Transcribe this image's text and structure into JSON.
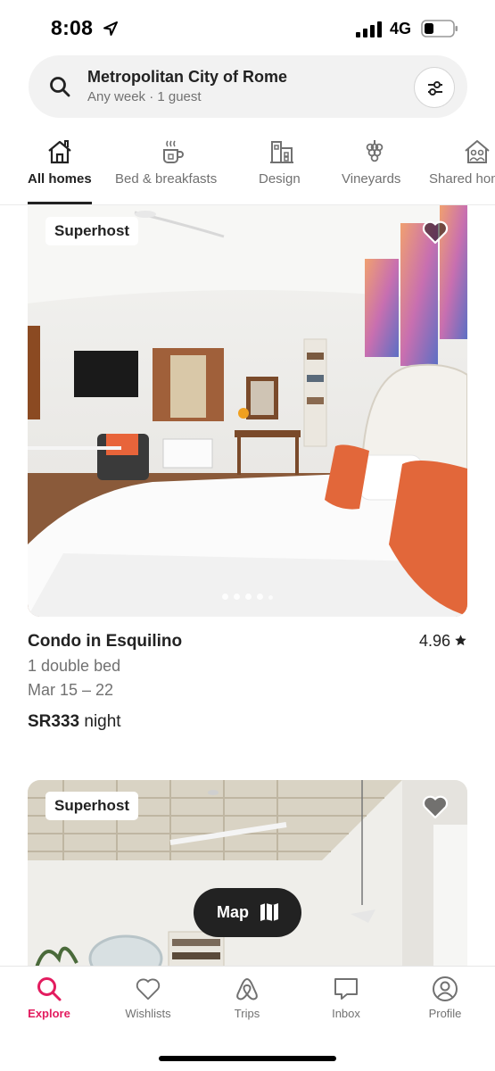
{
  "status": {
    "time": "8:08",
    "network": "4G"
  },
  "search": {
    "title": "Metropolitan City of Rome",
    "subtitle": "Any week · 1 guest"
  },
  "categories": [
    {
      "label": "All homes",
      "icon": "home-icon",
      "active": true
    },
    {
      "label": "Bed & breakfasts",
      "icon": "mug-icon"
    },
    {
      "label": "Design",
      "icon": "building-icon"
    },
    {
      "label": "Vineyards",
      "icon": "grapes-icon"
    },
    {
      "label": "Shared homes",
      "icon": "shared-home-icon"
    }
  ],
  "listings": [
    {
      "badge": "Superhost",
      "title": "Condo in Esquilino",
      "rating": "4.96",
      "beds": "1 double bed",
      "dates": "Mar 15 – 22",
      "price": "SR333",
      "price_unit": " night",
      "photos_count": 5
    },
    {
      "badge": "Superhost"
    }
  ],
  "map_button": {
    "label": "Map",
    "icon": "map-icon"
  },
  "nav": [
    {
      "label": "Explore",
      "icon": "search-icon",
      "active": true
    },
    {
      "label": "Wishlists",
      "icon": "heart-icon"
    },
    {
      "label": "Trips",
      "icon": "airbnb-logo-icon"
    },
    {
      "label": "Inbox",
      "icon": "message-icon"
    },
    {
      "label": "Profile",
      "icon": "profile-icon"
    }
  ],
  "colors": {
    "accent": "#E31C5F",
    "text": "#222222",
    "muted": "#717171",
    "map_button": "#222222"
  }
}
